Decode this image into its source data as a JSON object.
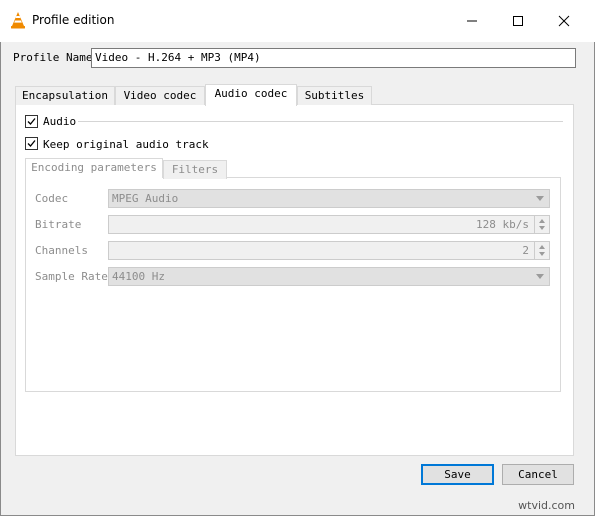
{
  "window": {
    "title": "Profile edition",
    "controls": {
      "minimize": "—",
      "maximize": "☐",
      "close": "✕"
    }
  },
  "profile_name": {
    "label": "Profile Name",
    "value": "Video - H.264 + MP3 (MP4)"
  },
  "tabs": [
    {
      "label": "Encapsulation",
      "active": false
    },
    {
      "label": "Video codec",
      "active": false
    },
    {
      "label": "Audio codec",
      "active": true
    },
    {
      "label": "Subtitles",
      "active": false
    }
  ],
  "audio": {
    "audio_checkbox_label": "Audio",
    "audio_checked": true,
    "keep_original_label": "Keep original audio track",
    "keep_original_checked": true
  },
  "subtabs": [
    {
      "label": "Encoding parameters",
      "active": true
    },
    {
      "label": "Filters",
      "active": false
    }
  ],
  "fields": {
    "codec": {
      "label": "Codec",
      "value": "MPEG Audio"
    },
    "bitrate": {
      "label": "Bitrate",
      "value": "128 kb/s"
    },
    "channels": {
      "label": "Channels",
      "value": "2"
    },
    "sample_rate": {
      "label": "Sample Rate",
      "value": "44100 Hz"
    }
  },
  "buttons": {
    "save": "Save",
    "cancel": "Cancel"
  },
  "watermark": "wtvid.com"
}
